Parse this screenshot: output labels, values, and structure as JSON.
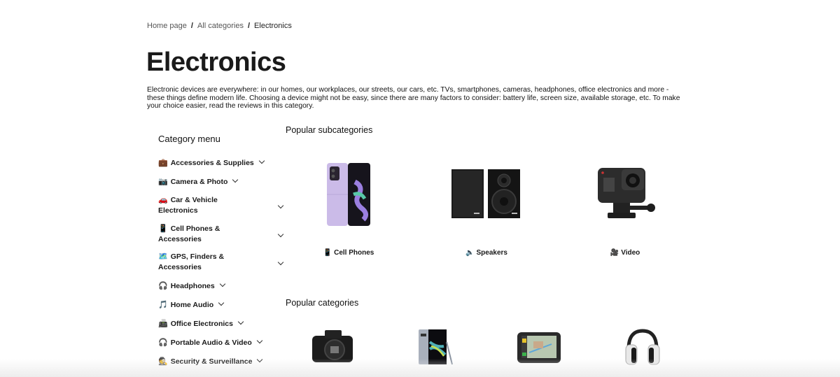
{
  "breadcrumb": {
    "items": [
      "Home page",
      "All categories",
      "Electronics"
    ],
    "separator": "/"
  },
  "page": {
    "title": "Electronics",
    "description": "Electronic devices are everywhere: in our homes, our workplaces, our streets, our cars, etc. TVs, smartphones, cameras, headphones, office electronics and more - these things define modern life. Choosing a device might not be easy, since there are many factors to consider: battery life, screen size, available storage, etc. To make your choice easier, read the reviews in this category."
  },
  "sidebar": {
    "title": "Category menu",
    "items": [
      {
        "emoji": "💼",
        "icon": "briefcase-icon",
        "label": "Accessories & Supplies"
      },
      {
        "emoji": "📷",
        "icon": "camera-icon",
        "label": "Camera & Photo"
      },
      {
        "emoji": "🚗",
        "icon": "car-icon",
        "label": "Car & Vehicle Electronics"
      },
      {
        "emoji": "📱",
        "icon": "mobile-phone-icon",
        "label": "Cell Phones & Accessories"
      },
      {
        "emoji": "🗺️",
        "icon": "map-icon",
        "label": "GPS, Finders & Accessories"
      },
      {
        "emoji": "🎧",
        "icon": "headphones-icon",
        "label": "Headphones"
      },
      {
        "emoji": "🎵",
        "icon": "music-note-icon",
        "label": "Home Audio"
      },
      {
        "emoji": "📠",
        "icon": "fax-machine-icon",
        "label": "Office Electronics"
      },
      {
        "emoji": "🎧",
        "icon": "headphones-icon",
        "label": "Portable Audio & Video"
      },
      {
        "emoji": "🕵️",
        "icon": "detective-icon",
        "label": "Security & Surveillance"
      }
    ]
  },
  "main": {
    "popular_subcategories": {
      "title": "Popular subcategories",
      "items": [
        {
          "emoji": "📱",
          "icon": "mobile-phone-icon",
          "label": "Cell Phones",
          "image": "folding-phone-image"
        },
        {
          "emoji": "🔈",
          "icon": "speaker-icon",
          "label": "Speakers",
          "image": "bookshelf-speakers-image"
        },
        {
          "emoji": "🎥",
          "icon": "movie-camera-icon",
          "label": "Video",
          "image": "action-camera-image"
        }
      ]
    },
    "popular_categories": {
      "title": "Popular categories",
      "items": [
        {
          "image": "dslr-camera-image"
        },
        {
          "image": "smartphone-stylus-image"
        },
        {
          "image": "gps-navigator-image"
        },
        {
          "image": "over-ear-headphones-image"
        }
      ]
    }
  },
  "colors": {
    "text": "#1d1d1f",
    "muted": "#555555",
    "background": "#ffffff",
    "phone_lavender": "#c9b8e8"
  }
}
